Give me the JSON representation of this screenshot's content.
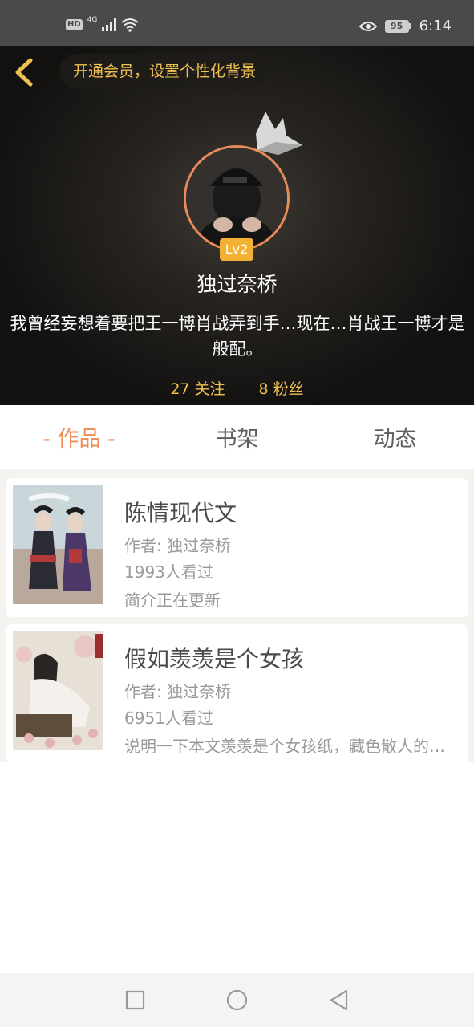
{
  "status_bar": {
    "hd": "HD",
    "network": "4G",
    "battery": "95",
    "time": "6:14",
    "icons": [
      "signal-icon",
      "wifi-icon",
      "eye-icon"
    ]
  },
  "header": {
    "vip_prompt": "开通会员，设置个性化背景",
    "level": "Lv2",
    "username": "独过奈桥",
    "bio": "我曾经妄想着要把王一博肖战弄到手…现在…肖战王一博才是般配。",
    "following": "27 关注",
    "followers": "8 粉丝"
  },
  "tabs": [
    {
      "label": "- 作品 -",
      "active": true
    },
    {
      "label": "书架",
      "active": false
    },
    {
      "label": "动态",
      "active": false
    }
  ],
  "books": [
    {
      "title": "陈情现代文",
      "author": "作者: 独过奈桥",
      "views": "1993人看过",
      "summary": "简介正在更新"
    },
    {
      "title": "假如羡羡是个女孩",
      "author": "作者: 独过奈桥",
      "views": "6951人看过",
      "summary": "说明一下本文羡羡是个女孩纸，藏色散人的女儿，师姐的师妹"
    }
  ],
  "colors": {
    "accent": "#ef8c52",
    "gold": "#f0c050",
    "level_badge": "#f2b134"
  },
  "nav": [
    "recent-apps-icon",
    "home-icon",
    "back-icon"
  ]
}
